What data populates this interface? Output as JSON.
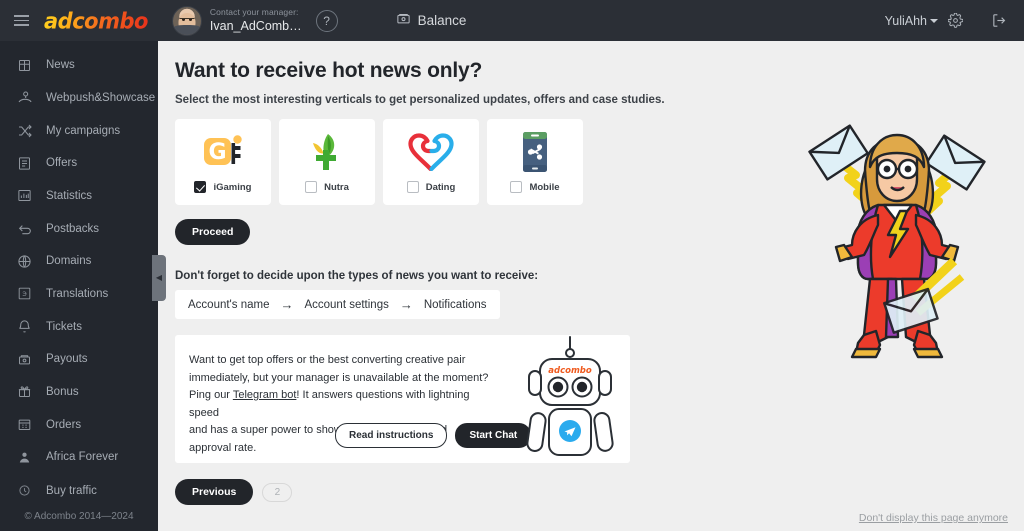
{
  "topbar": {
    "menu_icon": "hamburger-icon",
    "logo_text": "adcombo",
    "manager_label": "Contact your manager:",
    "manager_name": "Ivan_AdComb…",
    "help_icon": "question-mark-icon",
    "balance_label": "Balance",
    "balance_icon": "safe-box-icon",
    "username": "YuliAhh",
    "settings_icon": "gear-icon",
    "logout_icon": "logout-icon"
  },
  "sidebar": {
    "items": [
      {
        "label": "News",
        "icon": "news-icon"
      },
      {
        "label": "Webpush&Showcase",
        "icon": "webpush-icon"
      },
      {
        "label": "My campaigns",
        "icon": "shuffle-icon"
      },
      {
        "label": "Offers",
        "icon": "list-document-icon"
      },
      {
        "label": "Statistics",
        "icon": "bar-chart-icon"
      },
      {
        "label": "Postbacks",
        "icon": "return-arrow-icon"
      },
      {
        "label": "Domains",
        "icon": "globe-icon"
      },
      {
        "label": "Translations",
        "icon": "translate-icon"
      },
      {
        "label": "Tickets",
        "icon": "bell-icon"
      },
      {
        "label": "Payouts",
        "icon": "safe-box-icon"
      },
      {
        "label": "Bonus",
        "icon": "gift-icon"
      },
      {
        "label": "Orders",
        "icon": "calendar-icon"
      },
      {
        "label": "Africa Forever",
        "icon": "person-icon"
      },
      {
        "label": "Buy traffic",
        "icon": "clock-icon"
      }
    ],
    "copyright": "© Adcombo 2014—2024",
    "collapse_handle_icon": "chevron-left-icon"
  },
  "main": {
    "title": "Want to receive hot news only?",
    "subtitle": "Select the most interesting verticals to get personalized updates, offers and case studies.",
    "verticals": [
      {
        "label": "iGaming",
        "icon": "igaming-icon",
        "checked": true
      },
      {
        "label": "Nutra",
        "icon": "nutra-leaf-icon",
        "checked": false
      },
      {
        "label": "Dating",
        "icon": "dating-heart-icon",
        "checked": false
      },
      {
        "label": "Mobile",
        "icon": "mobile-share-icon",
        "checked": false
      }
    ],
    "proceed_label": "Proceed",
    "hint": "Don't forget to decide upon the types of news you want to receive:",
    "breadcrumb": [
      "Account's name",
      "Account settings",
      "Notifications"
    ],
    "breadcrumb_arrow": "→",
    "promo": {
      "line1": "Want to get top offers or the best converting creative pair",
      "line2": "immediately, but your manager is unavailable at the moment?",
      "line3_pre": "Ping our ",
      "line3_link": "Telegram bot",
      "line3_post": "! It answers questions with lightning speed",
      "line4": "and has a super power to show an offer's payout and approval rate.",
      "read_instructions_label": "Read instructions",
      "start_chat_label": "Start Chat",
      "robot_icon": "telegram-robot-illustration",
      "robot_logo_text": "adcombo",
      "robot_badge_icon": "telegram-icon"
    },
    "pager": {
      "previous_label": "Previous",
      "page_number": "2"
    },
    "hero_icon": "superhero-woman-illustration",
    "dont_display_label": "Don't display this page anymore"
  },
  "colors": {
    "topbar_bg": "#2b2f36",
    "sidebar_bg": "#23272e",
    "main_bg": "#efefef",
    "card_bg": "#ffffff",
    "dark_button": "#22252a",
    "logo_yellow": "#ffd21f",
    "logo_red": "#e8301b",
    "igaming_orange": "#ffc255",
    "nutra_green": "#3aa92f",
    "dating_red": "#e8303a",
    "dating_blue": "#29aeea",
    "mobile_blue": "#46607f",
    "telegram_blue": "#2aabee"
  }
}
